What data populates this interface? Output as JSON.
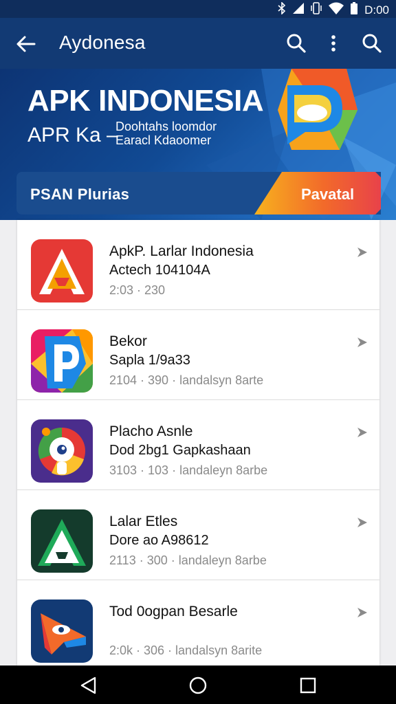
{
  "status_bar": {
    "time": "D:00",
    "icons": [
      "bluetooth-icon",
      "signal-icon",
      "vibrate-icon",
      "wifi-icon",
      "battery-icon"
    ]
  },
  "app_bar": {
    "title": "Aydonesa",
    "icons": [
      "back-arrow-icon",
      "search-icon",
      "more-vert-icon",
      "search-icon"
    ]
  },
  "banner": {
    "title": "APK INDONESIA",
    "subtitle": "APR Ka –",
    "tagline_line1": "Doohtahs loomdor",
    "tagline_line2": "Earacl Kdaoomer",
    "strip_label": "PSAN  Plurias",
    "cta_label": "Pavatal",
    "colors": {
      "deep_blue": "#0d3474",
      "cta_orange": "#f2a20c",
      "cta_red": "#e8424a"
    }
  },
  "apps": [
    {
      "name": "ApkP. Larlar Indonesia",
      "developer": "Actech 104104A",
      "meta": "2:03 · 230",
      "icon": "red-a-icon"
    },
    {
      "name": "Bekor",
      "developer": "Sapla 1/9a33",
      "meta": "2104 · 390 ·  landalsyn 8arte",
      "icon": "colorful-p-icon"
    },
    {
      "name": "Placho Asnle",
      "developer": "Dod 2bg1 Gapkashaan",
      "meta": "3103 · 103  ·  landaleyn 8arbe",
      "icon": "mascot-icon"
    },
    {
      "name": "Lalar Etles",
      "developer": "Dore ao A98612",
      "meta": "2113 · 300  ·  landaleyn 8arbe",
      "icon": "green-a-icon"
    },
    {
      "name": "Tod 0ogpan Besarle",
      "developer": "",
      "meta": "2:0k · 306  ·  landalsyn 8arite",
      "icon": "eye-arrow-icon"
    }
  ],
  "nav_bar": {
    "icons": [
      "back-triangle-icon",
      "home-circle-icon",
      "recents-square-icon"
    ]
  }
}
